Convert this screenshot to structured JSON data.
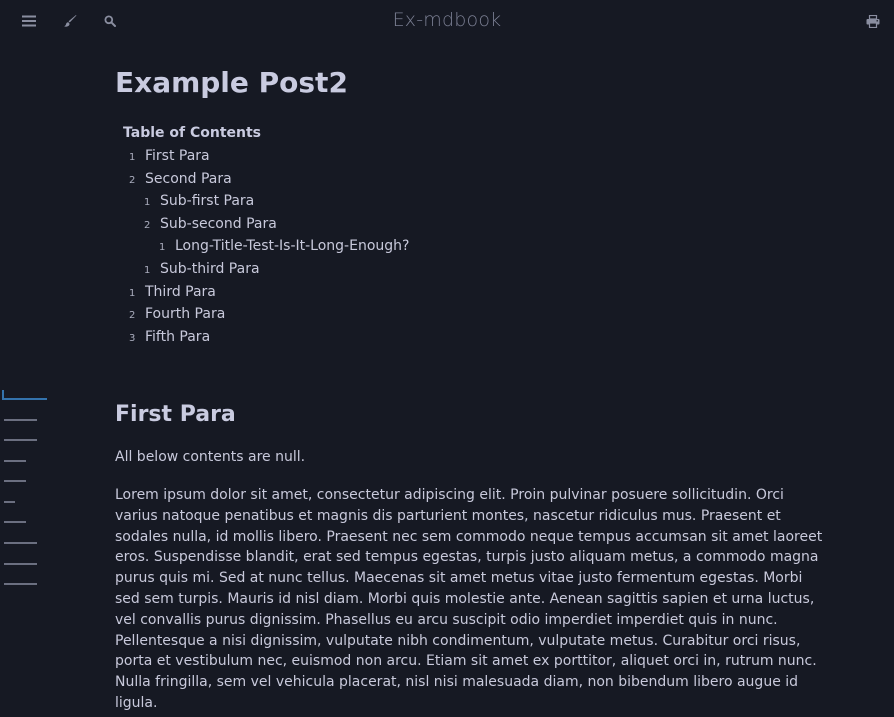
{
  "header": {
    "title": "Ex-mdbook",
    "icons": [
      "hamburger-icon",
      "paintbrush-icon",
      "search-icon",
      "print-icon"
    ]
  },
  "colors": {
    "background": "#161923",
    "text": "#c8c9db",
    "title_text": "#7b7f93",
    "minimap_active": "#3473ad",
    "minimap_inactive": "#6b6f80"
  },
  "page": {
    "title": "Example Post2"
  },
  "toc": {
    "heading": "Table of Contents",
    "items": [
      {
        "number": "1",
        "label": "First Para",
        "level": 1
      },
      {
        "number": "2",
        "label": "Second Para",
        "level": 1
      },
      {
        "number": "1",
        "label": "Sub-first Para",
        "level": 2
      },
      {
        "number": "2",
        "label": "Sub-second Para",
        "level": 2
      },
      {
        "number": "1",
        "label": "Long-Title-Test-Is-It-Long-Enough?",
        "level": 3
      },
      {
        "number": "1",
        "label": "Sub-third Para",
        "level": 2
      },
      {
        "number": "1",
        "label": "Third Para",
        "level": 1
      },
      {
        "number": "2",
        "label": "Fourth Para",
        "level": 1
      },
      {
        "number": "3",
        "label": "Fifth Para",
        "level": 1
      }
    ]
  },
  "section": {
    "heading": "First Para",
    "intro": "All below contents are null.",
    "paragraph_lines": [
      "Lorem ipsum dolor sit amet, consectetur adipiscing elit. Proin pulvinar posuere sollicitudin. Orci",
      "varius natoque penatibus et magnis dis parturient montes, nascetur ridiculus mus. Praesent et",
      "sodales nulla, id mollis libero. Praesent nec sem commodo neque tempus accumsan sit amet laoreet",
      "eros. Suspendisse blandit, erat sed tempus egestas, turpis justo aliquam metus, a commodo magna",
      "purus quis mi. Sed at nunc tellus. Maecenas sit amet metus vitae justo fermentum egestas. Morbi",
      "sed sem turpis. Mauris id nisl diam. Morbi quis molestie ante. Aenean sagittis sapien et urna luctus,",
      "vel convallis purus dignissim. Phasellus eu arcu suscipit odio imperdiet imperdiet quis in nunc.",
      "Pellentesque a nisi dignissim, vulputate nibh condimentum, vulputate metus. Curabitur orci risus,",
      "porta et vestibulum nec, euismod non arcu. Etiam sit amet ex porttitor, aliquet orci in, rutrum nunc.",
      "Nulla fringilla, sem vel vehicula placerat, nisl nisi malesuada diam, non bibendum libero augue id",
      "ligula."
    ]
  }
}
